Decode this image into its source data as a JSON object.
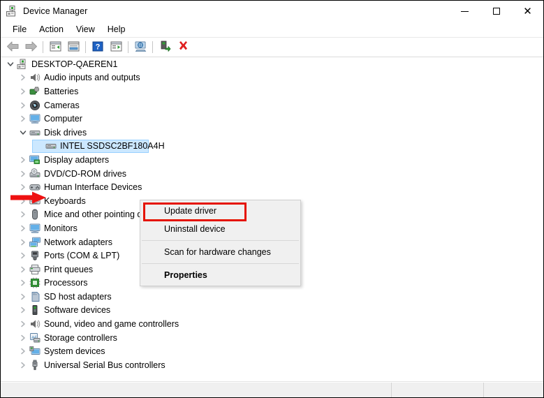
{
  "window": {
    "title": "Device Manager",
    "icon": "device-manager-icon"
  },
  "caption": {
    "minimize_label": "Minimize",
    "maximize_label": "Maximize",
    "close_label": "Close"
  },
  "menubar": {
    "items": [
      {
        "label": "File"
      },
      {
        "label": "Action"
      },
      {
        "label": "View"
      },
      {
        "label": "Help"
      }
    ]
  },
  "toolbar": {
    "buttons": [
      {
        "name": "back-icon",
        "label": "Back"
      },
      {
        "name": "forward-icon",
        "label": "Forward"
      },
      {
        "name": "separator",
        "label": ""
      },
      {
        "name": "show-hide-console-tree-icon",
        "label": "Show/Hide Console Tree"
      },
      {
        "name": "properties-icon",
        "label": "Properties"
      },
      {
        "name": "separator",
        "label": ""
      },
      {
        "name": "help-icon",
        "label": "Help"
      },
      {
        "name": "update-driver-icon",
        "label": "Update Driver Software"
      },
      {
        "name": "separator",
        "label": ""
      },
      {
        "name": "scan-hardware-changes-icon",
        "label": "Scan for hardware changes"
      },
      {
        "name": "separator",
        "label": ""
      },
      {
        "name": "enable-device-icon",
        "label": "Enable device"
      },
      {
        "name": "uninstall-device-icon",
        "label": "Uninstall device"
      }
    ]
  },
  "tree": {
    "items": [
      {
        "label": "DESKTOP-QAEREN1",
        "level": 0,
        "twisty": "expanded",
        "icon": "computer-root-icon",
        "selected": false
      },
      {
        "label": "Audio inputs and outputs",
        "level": 1,
        "twisty": "collapsed",
        "icon": "speaker-icon",
        "selected": false
      },
      {
        "label": "Batteries",
        "level": 1,
        "twisty": "collapsed",
        "icon": "battery-icon",
        "selected": false
      },
      {
        "label": "Cameras",
        "level": 1,
        "twisty": "collapsed",
        "icon": "camera-icon",
        "selected": false
      },
      {
        "label": "Computer",
        "level": 1,
        "twisty": "collapsed",
        "icon": "monitor-icon",
        "selected": false
      },
      {
        "label": "Disk drives",
        "level": 1,
        "twisty": "expanded",
        "icon": "disk-drive-icon",
        "selected": false
      },
      {
        "label": "INTEL SSDSC2BF180A4H",
        "level": 2,
        "twisty": "none",
        "icon": "disk-drive-icon",
        "selected": true
      },
      {
        "label": "Display adapters",
        "level": 1,
        "twisty": "collapsed",
        "icon": "display-adapter-icon",
        "selected": false
      },
      {
        "label": "DVD/CD-ROM drives",
        "level": 1,
        "twisty": "collapsed",
        "icon": "dvd-drive-icon",
        "selected": false
      },
      {
        "label": "Human Interface Devices",
        "level": 1,
        "twisty": "collapsed",
        "icon": "hid-icon",
        "selected": false
      },
      {
        "label": "Keyboards",
        "level": 1,
        "twisty": "collapsed",
        "icon": "keyboard-icon",
        "selected": false
      },
      {
        "label": "Mice and other pointing devices",
        "level": 1,
        "twisty": "collapsed",
        "icon": "mouse-icon",
        "selected": false
      },
      {
        "label": "Monitors",
        "level": 1,
        "twisty": "collapsed",
        "icon": "monitor-icon",
        "selected": false
      },
      {
        "label": "Network adapters",
        "level": 1,
        "twisty": "collapsed",
        "icon": "network-adapter-icon",
        "selected": false
      },
      {
        "label": "Ports (COM & LPT)",
        "level": 1,
        "twisty": "collapsed",
        "icon": "port-icon",
        "selected": false
      },
      {
        "label": "Print queues",
        "level": 1,
        "twisty": "collapsed",
        "icon": "printer-icon",
        "selected": false
      },
      {
        "label": "Processors",
        "level": 1,
        "twisty": "collapsed",
        "icon": "processor-icon",
        "selected": false
      },
      {
        "label": "SD host adapters",
        "level": 1,
        "twisty": "collapsed",
        "icon": "sd-card-icon",
        "selected": false
      },
      {
        "label": "Software devices",
        "level": 1,
        "twisty": "collapsed",
        "icon": "software-device-icon",
        "selected": false
      },
      {
        "label": "Sound, video and game controllers",
        "level": 1,
        "twisty": "collapsed",
        "icon": "speaker-icon",
        "selected": false
      },
      {
        "label": "Storage controllers",
        "level": 1,
        "twisty": "collapsed",
        "icon": "storage-controller-icon",
        "selected": false
      },
      {
        "label": "System devices",
        "level": 1,
        "twisty": "collapsed",
        "icon": "system-device-icon",
        "selected": false
      },
      {
        "label": "Universal Serial Bus controllers",
        "level": 1,
        "twisty": "collapsed",
        "icon": "usb-icon",
        "selected": false
      }
    ]
  },
  "context_menu": {
    "items": [
      {
        "label": "Update driver",
        "bold": false,
        "highlighted": true
      },
      {
        "label": "Uninstall device",
        "bold": false,
        "highlighted": false
      },
      {
        "label": "Scan for hardware changes",
        "bold": false,
        "highlighted": false
      },
      {
        "label": "Properties",
        "bold": true,
        "highlighted": false
      }
    ]
  },
  "annotation": {
    "arrow_color": "#ee1111",
    "highlight_color": "#e51400"
  },
  "statusbar": {
    "pane1": "",
    "pane2": "",
    "pane3": ""
  }
}
